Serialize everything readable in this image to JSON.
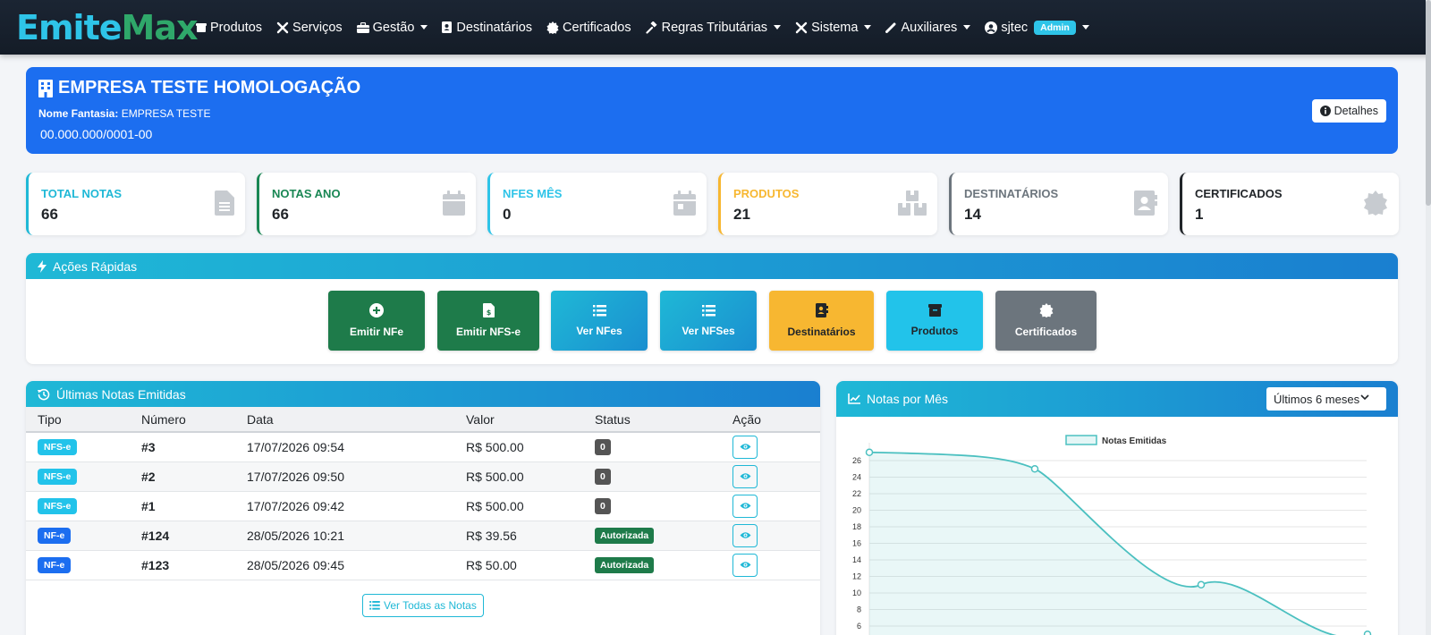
{
  "navbar": {
    "logo_left": "Emite",
    "logo_right": "Max",
    "items": [
      {
        "label": "Produtos"
      },
      {
        "label": "Serviços"
      },
      {
        "label": "Gestão"
      },
      {
        "label": "Destinatários"
      },
      {
        "label": "Certificados"
      },
      {
        "label": "Regras Tributárias"
      },
      {
        "label": "Sistema"
      },
      {
        "label": "Auxiliares"
      }
    ],
    "user": "sjtec",
    "user_badge": "Admin"
  },
  "company": {
    "name": "EMPRESA TESTE HOMOLOGAÇÃO",
    "fantasia_label": "Nome Fantasia:",
    "fantasia_value": "EMPRESA TESTE",
    "cnpj": "00.000.000/0001-00",
    "details_button": "Detalhes"
  },
  "stats": [
    {
      "label": "Total Notas",
      "value": "66",
      "color": "#1fb8d6"
    },
    {
      "label": "Notas Ano",
      "value": "66",
      "color": "#198754"
    },
    {
      "label": "NFes Mês",
      "value": "0",
      "color": "#2ec4e8"
    },
    {
      "label": "Produtos",
      "value": "21",
      "color": "#f7b731"
    },
    {
      "label": "Destinatários",
      "value": "14",
      "color": "#6c757d"
    },
    {
      "label": "Certificados",
      "value": "1",
      "color": "#212529"
    }
  ],
  "quick_actions": {
    "title": "Ações Rápidas",
    "buttons": [
      {
        "label": "Emitir NFe",
        "icon": "plus-circle-icon"
      },
      {
        "label": "Emitir NFS-e",
        "icon": "file-invoice-dollar-icon"
      },
      {
        "label": "Ver NFes",
        "icon": "list-icon"
      },
      {
        "label": "Ver NFSes",
        "icon": "list-icon"
      },
      {
        "label": "Destinatários",
        "icon": "address-book-icon"
      },
      {
        "label": "Produtos",
        "icon": "box-icon"
      },
      {
        "label": "Certificados",
        "icon": "certificate-icon"
      }
    ]
  },
  "notes": {
    "title": "Últimas Notas Emitidas",
    "columns": [
      "Tipo",
      "Número",
      "Data",
      "Valor",
      "Status",
      "Ação"
    ],
    "rows": [
      {
        "tipo": "NFS-e",
        "numero": "#3",
        "data": "17/07/2026 09:54",
        "valor": "R$ 500.00",
        "status": "0"
      },
      {
        "tipo": "NFS-e",
        "numero": "#2",
        "data": "17/07/2026 09:50",
        "valor": "R$ 500.00",
        "status": "0"
      },
      {
        "tipo": "NFS-e",
        "numero": "#1",
        "data": "17/07/2026 09:42",
        "valor": "R$ 500.00",
        "status": "0"
      },
      {
        "tipo": "NF-e",
        "numero": "#124",
        "data": "28/05/2026 10:21",
        "valor": "R$ 39.56",
        "status": "Autorizada"
      },
      {
        "tipo": "NF-e",
        "numero": "#123",
        "data": "28/05/2026 09:45",
        "valor": "R$ 50.00",
        "status": "Autorizada"
      }
    ],
    "view_all": "Ver Todas as Notas"
  },
  "chart_panel": {
    "title": "Notas por Mês",
    "period": "Últimos 6 meses"
  },
  "chart_data": {
    "type": "area",
    "legend": [
      "Notas Emitidas"
    ],
    "series": [
      {
        "name": "Notas Emitidas",
        "values": [
          27,
          25,
          11,
          5
        ]
      }
    ],
    "y_ticks": [
      6,
      8,
      10,
      12,
      14,
      16,
      18,
      20,
      22,
      24,
      26
    ],
    "color": "#4bc0c0"
  }
}
